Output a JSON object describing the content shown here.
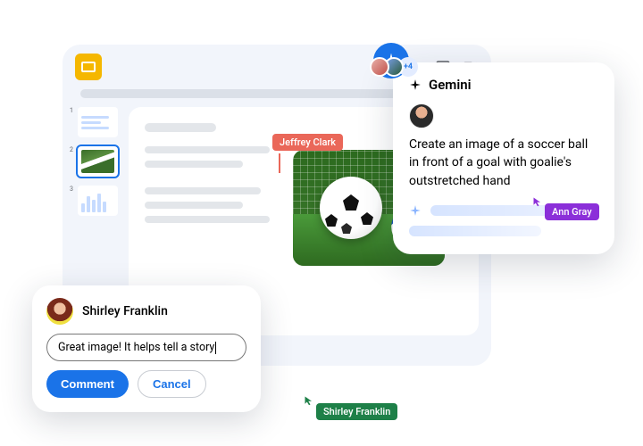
{
  "header": {
    "plus_count": "+4"
  },
  "thumbnails": {
    "n1": "1",
    "n2": "2",
    "n3": "3"
  },
  "collaborators": {
    "jeffrey": "Jeffrey Clark",
    "ann": "Ann Gray",
    "shirley": "Shirley Franklin"
  },
  "gemini": {
    "title": "Gemini",
    "prompt": "Create an image of a soccer ball in front of a goal with goalie's outstretched hand"
  },
  "comment": {
    "author": "Shirley Franklin",
    "text": "Great image! It helps tell a story",
    "submit": "Comment",
    "cancel": "Cancel"
  }
}
